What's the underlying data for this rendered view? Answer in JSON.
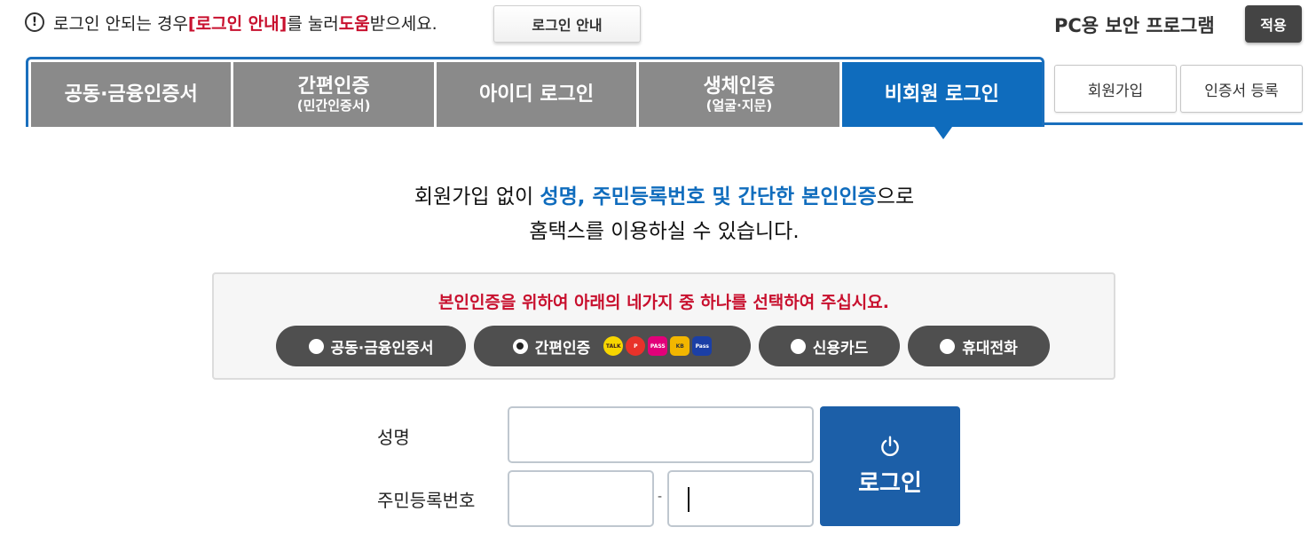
{
  "notice": {
    "part1": "로그인 안되는 경우 ",
    "highlight1": "[로그인 안내]",
    "part2": "를 눌러 ",
    "highlight2": "도움",
    "part3": "받으세요.",
    "button": "로그인 안내"
  },
  "security": {
    "label": "PC용 보안 프로그램",
    "apply": "적용"
  },
  "tabs": [
    {
      "label": "공동·금융인증서",
      "sub": ""
    },
    {
      "label": "간편인증",
      "sub": "(민간인증서)"
    },
    {
      "label": "아이디 로그인",
      "sub": ""
    },
    {
      "label": "생체인증",
      "sub": "(얼굴·지문)"
    },
    {
      "label": "비회원 로그인",
      "sub": "",
      "active": true
    }
  ],
  "side_buttons": {
    "signup": "회원가입",
    "cert_register": "인증서 등록"
  },
  "intro": {
    "line1_a": "회원가입 없이 ",
    "line1_hl": "성명, 주민등록번호 및 간단한 본인인증",
    "line1_b": "으로",
    "line2": "홈택스를 이용하실 수 있습니다."
  },
  "verify": {
    "title": "본인인증을 위하여 아래의 네가지 중 하나를 선택하여 주십시요.",
    "options": [
      {
        "label": "공동·금융인증서",
        "selected": false
      },
      {
        "label": "간편인증",
        "selected": true
      },
      {
        "label": "신용카드",
        "selected": false
      },
      {
        "label": "휴대전화",
        "selected": false
      }
    ],
    "provider_icons": [
      "kakao-icon",
      "payco-icon",
      "pass-icon",
      "kb-icon",
      "samsung-pass-icon"
    ]
  },
  "form": {
    "name_label": "성명",
    "rrn_label": "주민등록번호",
    "dash": "-",
    "login_label": "로그인"
  },
  "colors": {
    "accent": "#0f6cbd",
    "tab_inactive": "#8a8a8a",
    "alert": "#c8102e",
    "login_button": "#1c5fa8"
  }
}
